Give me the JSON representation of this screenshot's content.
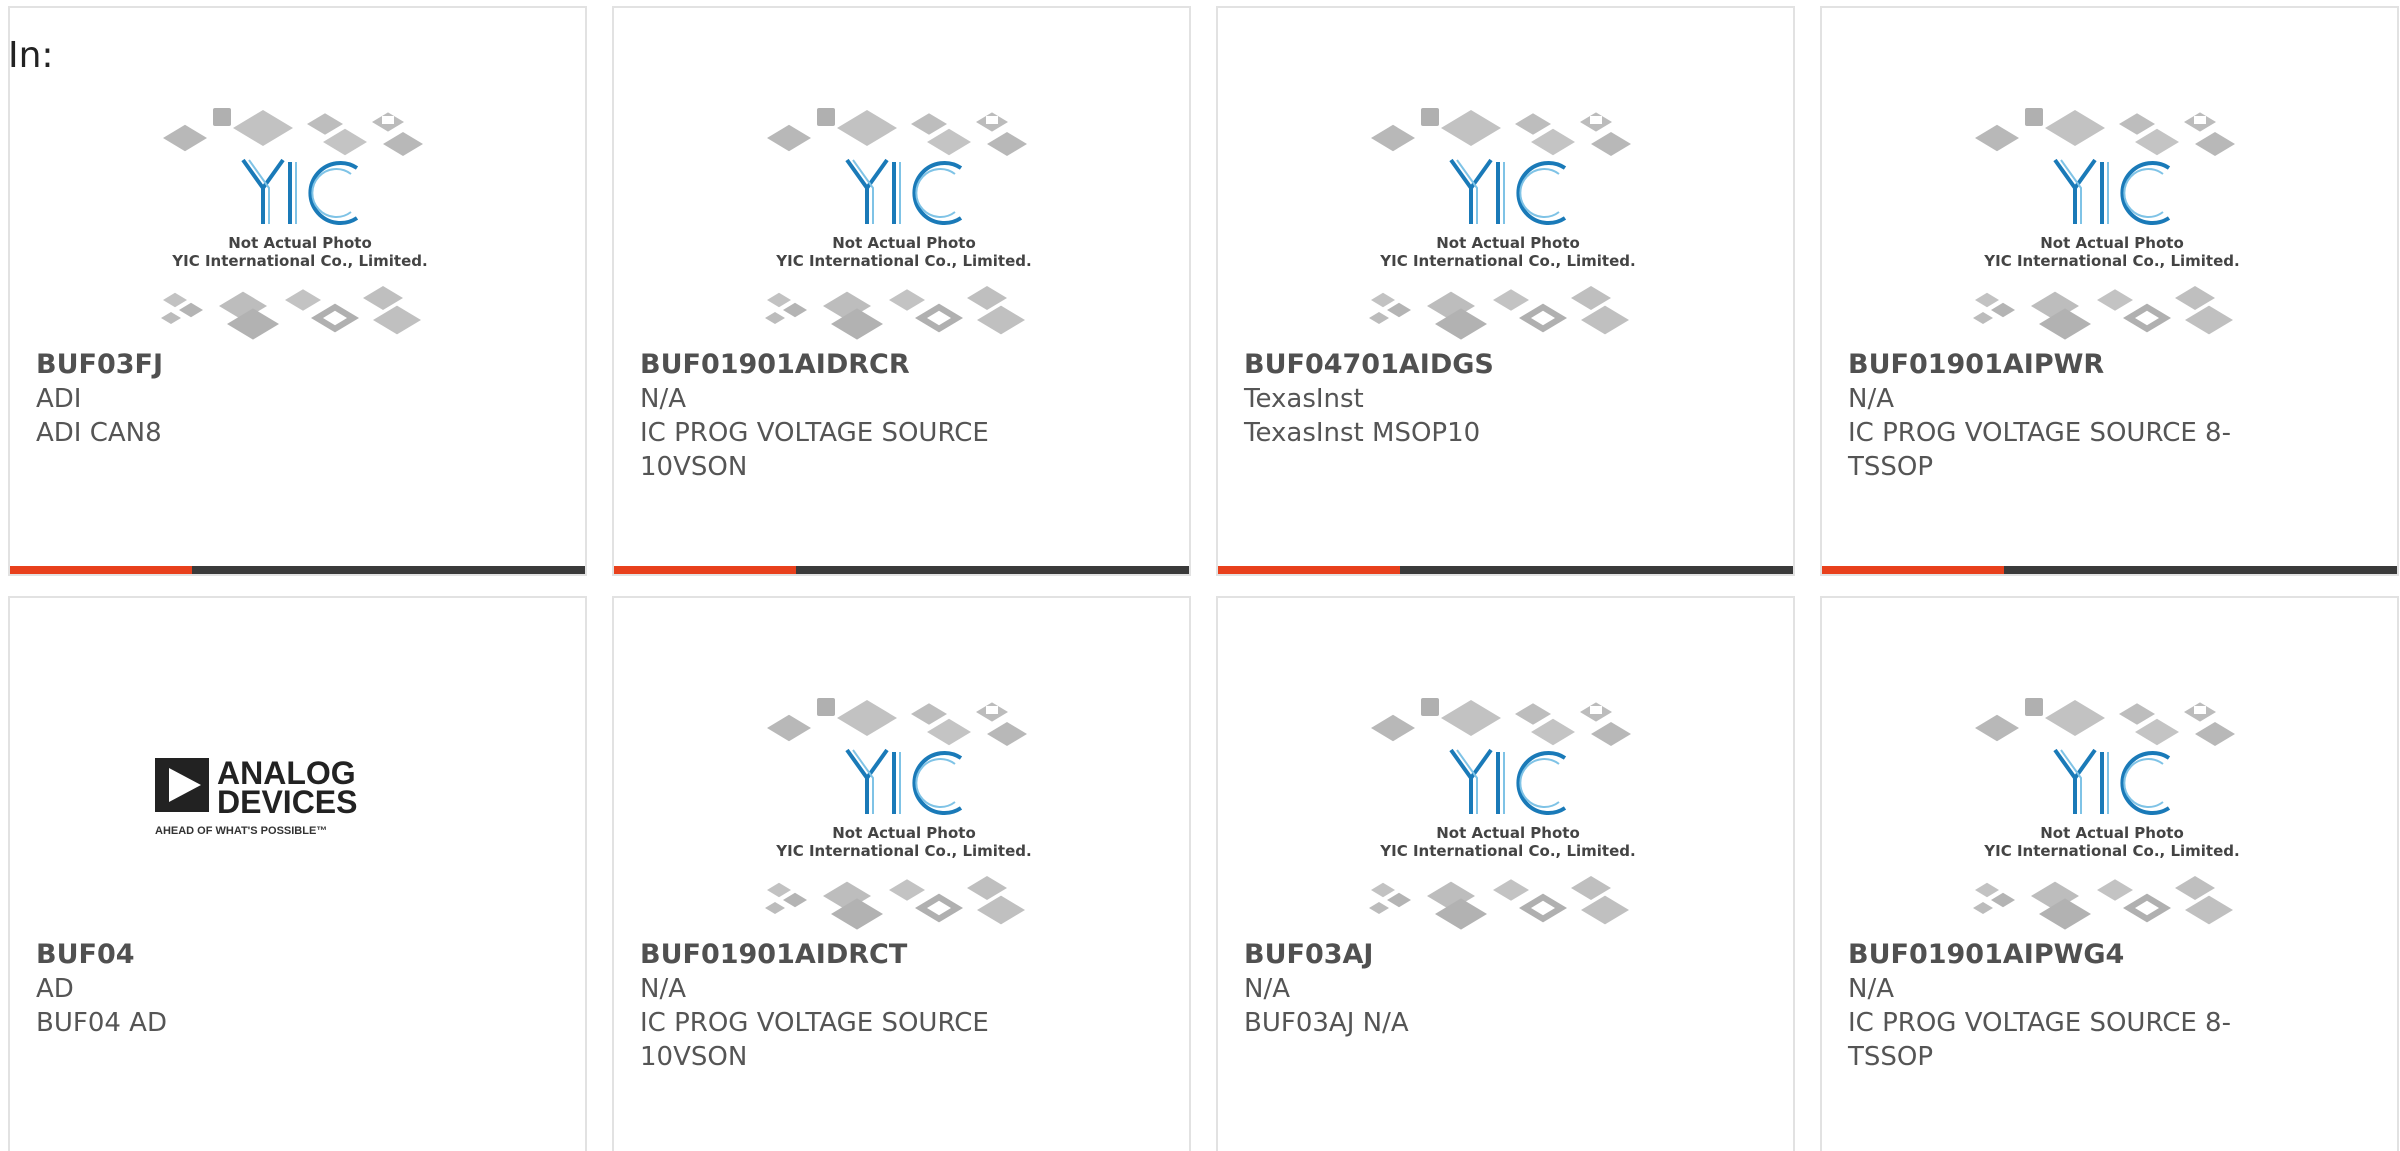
{
  "filter_label": "In:",
  "placeholder": {
    "line1": "Not Actual Photo",
    "line2": "YIC International Co., Limited."
  },
  "brand_logo": {
    "line1": "ANALOG",
    "line2": "DEVICES",
    "tagline": "AHEAD OF WHAT'S POSSIBLE™"
  },
  "colors": {
    "accent": "#e8401c",
    "bar": "#3a3a3a",
    "logo_blue": "#1a7ab8"
  },
  "products": [
    {
      "part": "BUF03FJ",
      "mfr": "ADI",
      "desc": "ADI CAN8",
      "image": "placeholder",
      "bar": true
    },
    {
      "part": "BUF01901AIDRCR",
      "mfr": "N/A",
      "desc": "IC PROG VOLTAGE SOURCE 10VSON",
      "image": "placeholder",
      "bar": true
    },
    {
      "part": "BUF04701AIDGS",
      "mfr": "TexasInst",
      "desc": "TexasInst MSOP10",
      "image": "placeholder",
      "bar": true
    },
    {
      "part": "BUF01901AIPWR",
      "mfr": "N/A",
      "desc": "IC PROG VOLTAGE SOURCE 8-TSSOP",
      "image": "placeholder",
      "bar": true
    },
    {
      "part": "BUF04",
      "mfr": "AD",
      "desc": "BUF04 AD",
      "image": "analog-devices",
      "bar": false
    },
    {
      "part": "BUF01901AIDRCT",
      "mfr": "N/A",
      "desc": "IC PROG VOLTAGE SOURCE 10VSON",
      "image": "placeholder",
      "bar": false
    },
    {
      "part": "BUF03AJ",
      "mfr": "N/A",
      "desc": "BUF03AJ N/A",
      "image": "placeholder",
      "bar": false
    },
    {
      "part": "BUF01901AIPWG4",
      "mfr": "N/A",
      "desc": "IC PROG VOLTAGE SOURCE 8-TSSOP",
      "image": "placeholder",
      "bar": false
    }
  ]
}
